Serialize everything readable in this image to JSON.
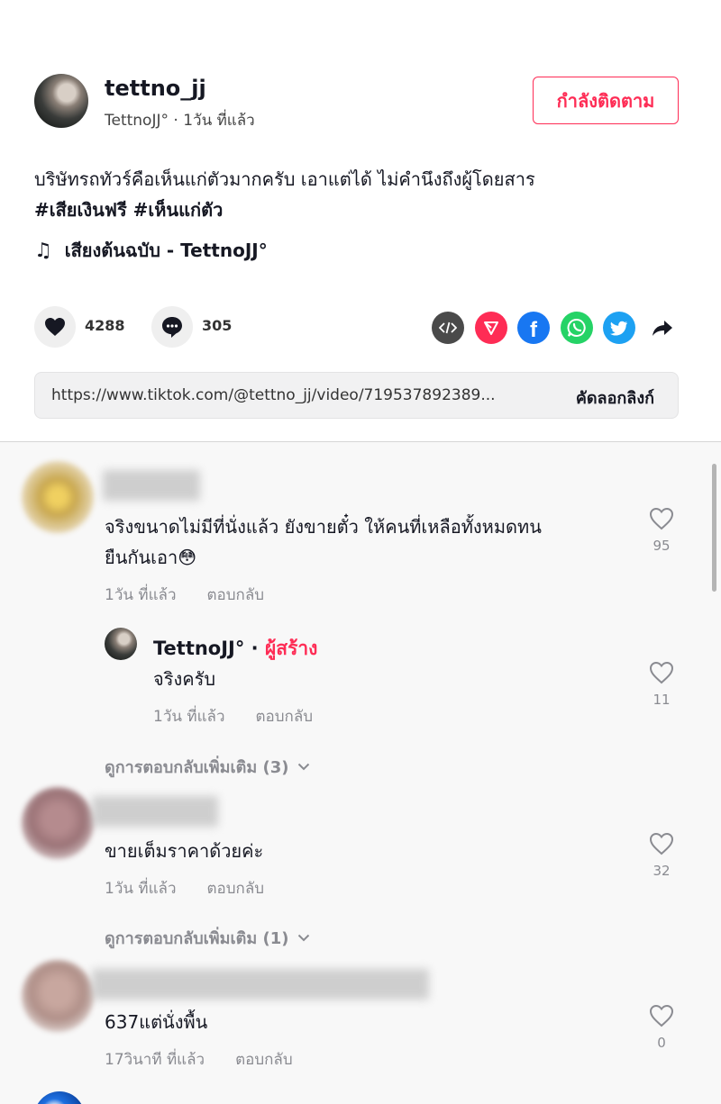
{
  "post": {
    "author_username": "tettno_jj",
    "author_display": "TettnoJJ°",
    "time_sep": " · ",
    "post_time": "1วัน ที่แล้ว",
    "follow_label": "กำลังติดตาม",
    "caption_text": "บริษัทรถทัวร์คือเห็นแก่ตัวมากครับ เอาแต่ได้ ไม่คำนึงถึงผู้โดยสาร",
    "caption_tags": "#เสียเงินฟรี #เห็นแก่ตัว",
    "music": "เสียงต้นฉบับ - TettnoJJ°",
    "likes": "4288",
    "comments": "305",
    "link_url": "https://www.tiktok.com/@tettno_jj/video/719537892389...",
    "copy_link_label": "คัดลอกลิงก์"
  },
  "share_icons": [
    {
      "name": "embed-icon",
      "color": "#4a4a4a"
    },
    {
      "name": "send-icon",
      "color": "#fe2c55"
    },
    {
      "name": "facebook-icon",
      "color": "#1877f2"
    },
    {
      "name": "whatsapp-icon",
      "color": "#25d366"
    },
    {
      "name": "twitter-icon",
      "color": "#1da1f2"
    },
    {
      "name": "share-arrow-icon",
      "color": "#161823"
    }
  ],
  "comments": [
    {
      "text_line1": "จริงขนาดไม่มีที่นั่งแล้ว ยังขายตั๋ว ให้คนที่เหลือทั้งหมดทน",
      "text_line2": "ยืนกันเอา😳",
      "time": "1วัน ที่แล้ว",
      "reply_label": "ตอบกลับ",
      "likes": "95",
      "reply": {
        "name": "TettnoJJ°",
        "sep": " · ",
        "creator_label": "ผู้สร้าง",
        "text": "จริงครับ",
        "time": "1วัน ที่แล้ว",
        "reply_label": "ตอบกลับ",
        "likes": "11"
      },
      "more_replies": "ดูการตอบกลับเพิ่มเติม (3)"
    },
    {
      "text": "ขายเต็มราคาด้วยค่ะ",
      "time": "1วัน ที่แล้ว",
      "reply_label": "ตอบกลับ",
      "likes": "32",
      "more_replies": "ดูการตอบกลับเพิ่มเติม (1)"
    },
    {
      "text": "637แต่นั่งพื้น",
      "time": "17วินาที ที่แล้ว",
      "reply_label": "ตอบกลับ",
      "likes": "0"
    }
  ]
}
